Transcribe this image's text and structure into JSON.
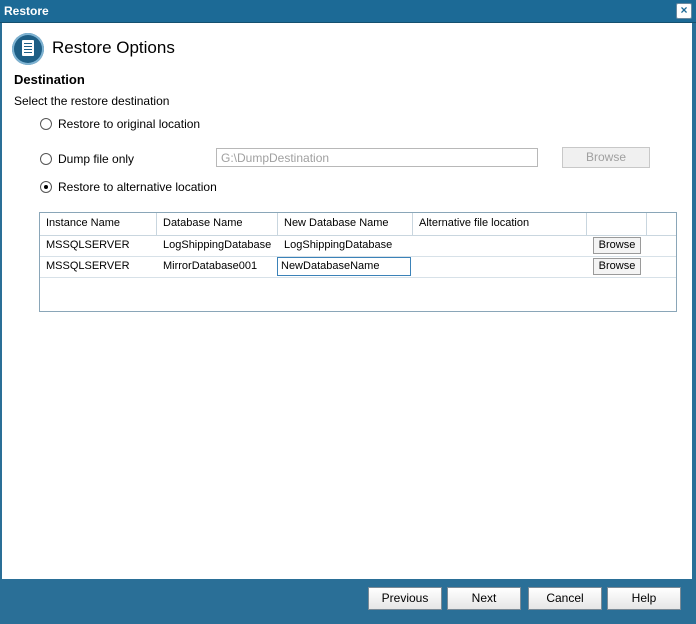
{
  "window": {
    "title": "Restore"
  },
  "header": {
    "title": "Restore Options",
    "icon": "document-list-icon"
  },
  "destination": {
    "heading": "Destination",
    "instruction": "Select the restore destination",
    "options": [
      {
        "label": "Restore to original location",
        "checked": false
      },
      {
        "label": "Dump file only",
        "checked": false
      },
      {
        "label": "Restore to alternative location",
        "checked": true
      }
    ],
    "dump_path_value": "G:\\DumpDestination",
    "browse_label": "Browse"
  },
  "table": {
    "columns": [
      "Instance Name",
      "Database Name",
      "New Database Name",
      "Alternative file location",
      ""
    ],
    "rows": [
      {
        "instance": "MSSQLSERVER",
        "database": "LogShippingDatabase",
        "new_name": "LogShippingDatabase",
        "alt_location": "",
        "browse": "Browse"
      },
      {
        "instance": "MSSQLSERVER",
        "database": "MirrorDatabase001",
        "new_name": "NewDatabaseName",
        "alt_location": "",
        "browse": "Browse"
      }
    ]
  },
  "footer": {
    "previous": "Previous",
    "next": "Next",
    "cancel": "Cancel",
    "help": "Help"
  },
  "colors": {
    "title_bar": "#1c6a96",
    "footer": "#2a6f97",
    "accent": "#3b82b8"
  }
}
